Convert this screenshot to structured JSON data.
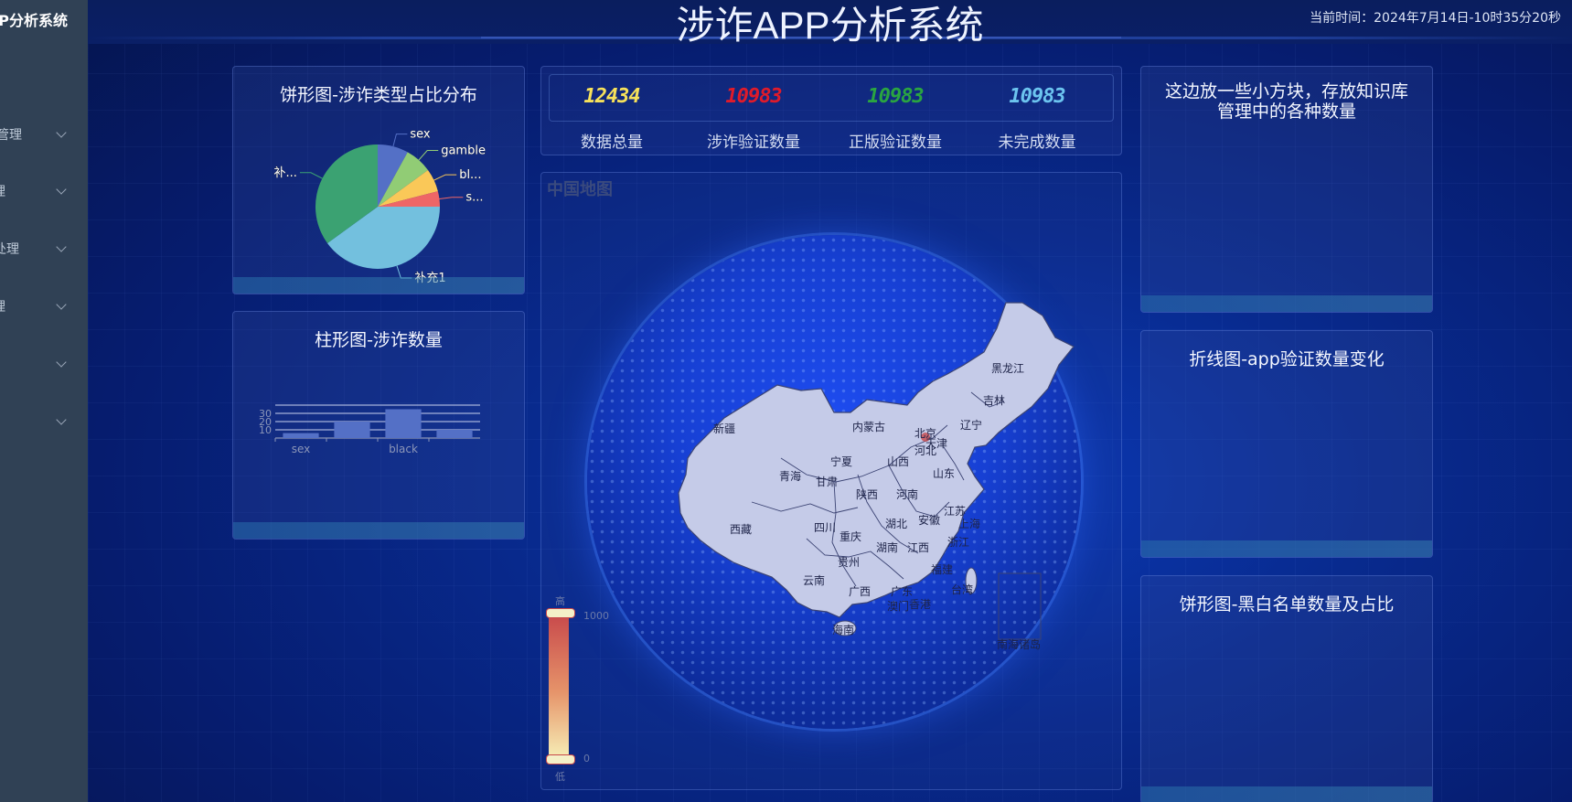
{
  "sidebar": {
    "brand": "涉诈APP分析系统",
    "items": [
      {
        "label": "管理"
      },
      {
        "label": "理"
      },
      {
        "label": "处理"
      },
      {
        "label": "理"
      },
      {
        "label": ""
      },
      {
        "label": ""
      }
    ]
  },
  "header": {
    "title": "涉诈APP分析系统",
    "clock": "当前时间：2024年7月14日-10时35分20秒"
  },
  "panels": {
    "pie_type": "饼形图-涉诈类型占比分布",
    "bar_count": "柱形图-涉诈数量",
    "knowledge": "这边放一些小方块，存放知识库管理中的各种数量",
    "line_verify": "折线图-app验证数量变化",
    "pie_list": "饼形图-黑白名单数量及占比",
    "map_title": "中国地图"
  },
  "stats": [
    {
      "value": "12434",
      "label": "数据总量",
      "color": "#f6e15a"
    },
    {
      "value": "10983",
      "label": "涉诈验证数量",
      "color": "#e01b2a"
    },
    {
      "value": "10983",
      "label": "正版验证数量",
      "color": "#2aa541"
    },
    {
      "value": "10983",
      "label": "未完成数量",
      "color": "#6cc4ef"
    }
  ],
  "map": {
    "legend_high": "高",
    "legend_low": "低",
    "legend_max": "1000",
    "legend_min": "0",
    "provinces": [
      "黑龙江",
      "吉林",
      "辽宁",
      "内蒙古",
      "北京",
      "天津",
      "河北",
      "新疆",
      "宁夏",
      "山西",
      "山东",
      "青海",
      "甘肃",
      "陕西",
      "河南",
      "江苏",
      "西藏",
      "四川",
      "湖北",
      "安徽",
      "上海",
      "重庆",
      "湖南",
      "江西",
      "浙江",
      "贵州",
      "福建",
      "云南",
      "广西",
      "广东",
      "台湾",
      "澳门",
      "香港",
      "海南",
      "南海诸岛"
    ]
  },
  "chart_data": [
    {
      "type": "pie",
      "title": "饼形图-涉诈类型占比分布",
      "labels": [
        "sex",
        "gamble",
        "bl...",
        "s...",
        "补充1",
        "补..."
      ],
      "values": [
        8,
        7,
        6,
        4,
        40,
        35
      ],
      "colors": [
        "#5470c6",
        "#91cc75",
        "#fac858",
        "#ee6666",
        "#73c0de",
        "#3ba272"
      ]
    },
    {
      "type": "bar",
      "title": "柱形图-涉诈数量",
      "categories": [
        "sex",
        "",
        "black",
        ""
      ],
      "values": [
        6,
        20,
        35,
        10
      ],
      "yticks": [
        10,
        20,
        30
      ],
      "ylim": [
        0,
        40
      ],
      "color": "#5470c6"
    }
  ]
}
